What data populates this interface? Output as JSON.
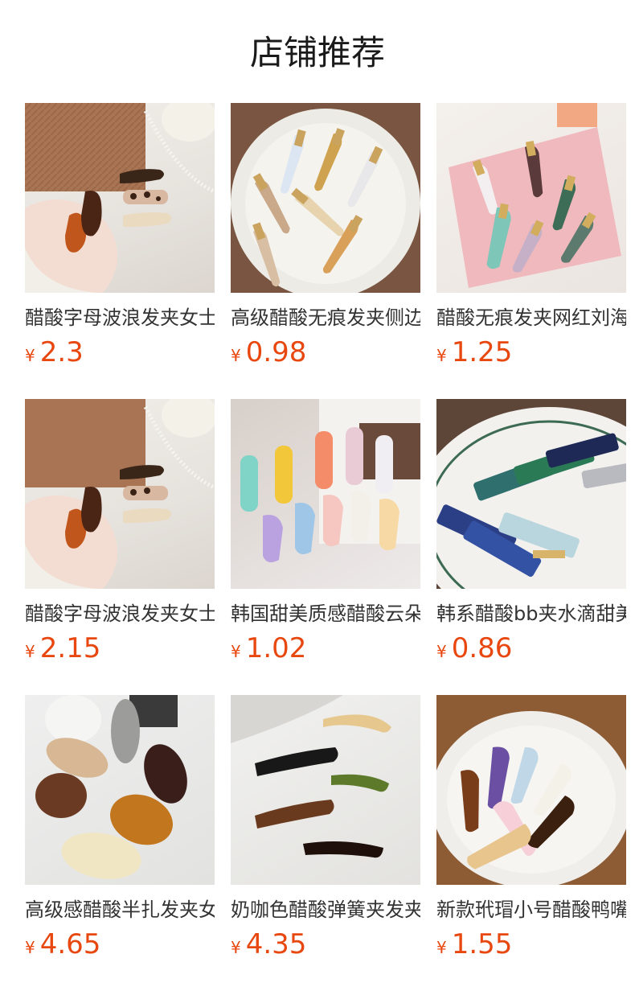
{
  "section": {
    "title": "店铺推荐"
  },
  "currency_symbol": "¥",
  "colors": {
    "price": "#e8470f",
    "title": "#1a1a1a",
    "name": "#333333"
  },
  "products": [
    {
      "name": "醋酸字母波浪发夹女士",
      "price": "2.3",
      "image": "hair-clip-photo"
    },
    {
      "name": "高级醋酸无痕发夹侧边",
      "price": "0.98",
      "image": "hair-clip-photo"
    },
    {
      "name": "醋酸无痕发夹网红刘海",
      "price": "1.25",
      "image": "hair-clip-photo"
    },
    {
      "name": "醋酸字母波浪发夹女士",
      "price": "2.15",
      "image": "hair-clip-photo"
    },
    {
      "name": "韩国甜美质感醋酸云朵",
      "price": "1.02",
      "image": "hair-clip-photo"
    },
    {
      "name": "韩系醋酸bb夹水滴甜美",
      "price": "0.86",
      "image": "hair-clip-photo"
    },
    {
      "name": "高级感醋酸半扎发夹女",
      "price": "4.65",
      "image": "hair-clip-photo"
    },
    {
      "name": "奶咖色醋酸弹簧夹发夹",
      "price": "4.35",
      "image": "hair-clip-photo"
    },
    {
      "name": "新款玳瑁小号醋酸鸭嘴",
      "price": "1.55",
      "image": "hair-clip-photo"
    }
  ]
}
